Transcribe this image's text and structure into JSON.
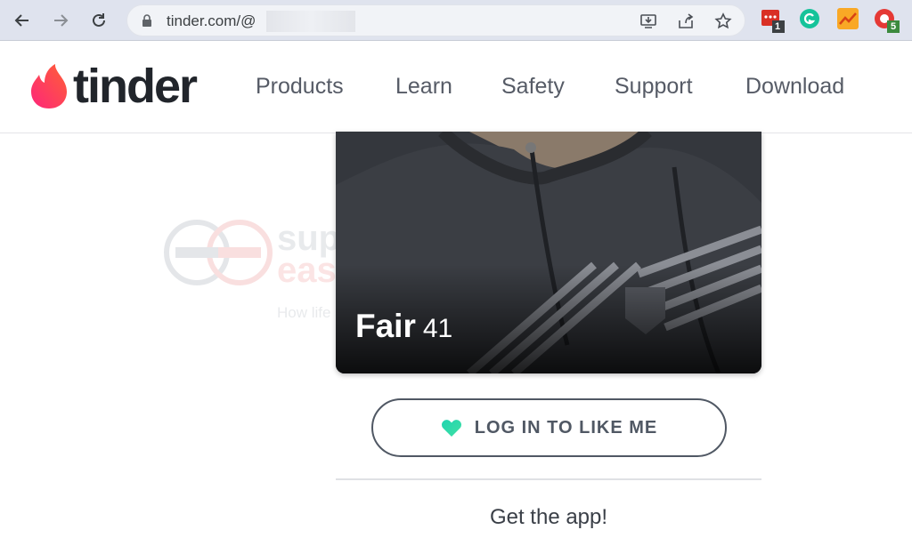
{
  "browser": {
    "url": "tinder.com/@",
    "extension_badges": {
      "first": "1",
      "last": "5"
    }
  },
  "site": {
    "logo_text": "tinder",
    "nav": [
      "Products",
      "Learn",
      "Safety",
      "Support",
      "Download"
    ]
  },
  "watermark": {
    "line1": "sup",
    "line2": "easy",
    "tagline": "How life sh"
  },
  "profile": {
    "name": "Fair",
    "age": "41"
  },
  "actions": {
    "login_label": "LOG IN TO LIKE ME",
    "get_app": "Get the app!"
  },
  "colors": {
    "brand_gradient_start": "#fd267a",
    "brand_gradient_end": "#ff6036",
    "heart": "#38d9a9"
  }
}
